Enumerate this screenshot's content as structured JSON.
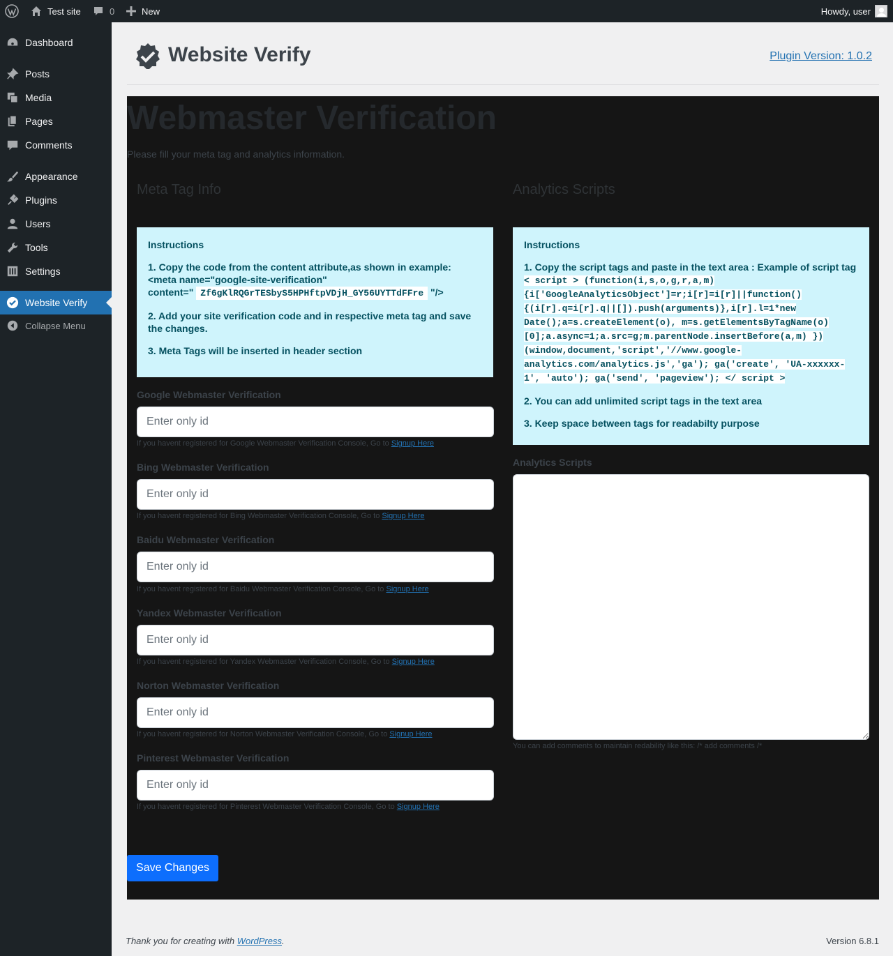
{
  "admin_bar": {
    "site_name": "Test site",
    "comments_count": "0",
    "new_label": "New",
    "howdy": "Howdy, user"
  },
  "sidebar": {
    "items": [
      {
        "label": "Dashboard",
        "icon": "dashboard-icon"
      },
      {
        "label": "Posts",
        "icon": "pin-icon"
      },
      {
        "label": "Media",
        "icon": "media-icon"
      },
      {
        "label": "Pages",
        "icon": "pages-icon"
      },
      {
        "label": "Comments",
        "icon": "comment-icon"
      },
      {
        "label": "Appearance",
        "icon": "brush-icon"
      },
      {
        "label": "Plugins",
        "icon": "plug-icon"
      },
      {
        "label": "Users",
        "icon": "user-icon"
      },
      {
        "label": "Tools",
        "icon": "wrench-icon"
      },
      {
        "label": "Settings",
        "icon": "settings-icon"
      },
      {
        "label": "Website Verify",
        "icon": "verified-badge-icon"
      },
      {
        "label": "Collapse Menu",
        "icon": "collapse-icon"
      }
    ],
    "active": "Website Verify"
  },
  "header": {
    "title": "Website Verify",
    "version_link": "Plugin Version: 1.0.2"
  },
  "panel": {
    "title": "Webmaster Verification",
    "subtitle": "Please fill your meta tag and analytics information.",
    "meta_col_title": "Meta Tag Info",
    "analytics_col_title": "Analytics Scripts"
  },
  "meta_instructions": {
    "heading": "Instructions",
    "step1": "1. Copy the code from the content attribute,as shown in example:",
    "step1_meta": "<meta name=\"google-site-verification\"",
    "step1_content_prefix": "content=\"",
    "step1_code": "Zf6gKlRQGrTESbyS5HPHftpVDjH_GY56UYTTdFFre",
    "step1_suffix": "\"/>",
    "step2": "2. Add your site verification code and in respective meta tag and save the changes.",
    "step3": "3. Meta Tags will be inserted in header section"
  },
  "analytics_instructions": {
    "heading": "Instructions",
    "step1": "1. Copy the script tags and paste in the text area : Example of script tag",
    "code": " < script > (function(i,s,o,g,r,a,m){i['GoogleAnalyticsObject']=r;i[r]=i[r]||function(){(i[r].q=i[r].q||[]).push(arguments)},i[r].l=1*new Date();a=s.createElement(o), m=s.getElementsByTagName(o)[0];a.async=1;a.src=g;m.parentNode.insertBefore(a,m) })(window,document,'script','//www.google-analytics.com/analytics.js','ga'); ga('create', 'UA-xxxxxx-1', 'auto'); ga('send', 'pageview'); </ script > ",
    "step2": "2. You can add unlimited script tags in the text area",
    "step3": "3. Keep space between tags for readabilty purpose"
  },
  "fields": [
    {
      "label": "Google Webmaster Verification",
      "placeholder": "Enter only id",
      "help": "If you havent registered for Google Webmaster Verification Console, Go to",
      "link": "Signup Here"
    },
    {
      "label": "Bing Webmaster Verification",
      "placeholder": "Enter only id",
      "help": "If you havent registered for Bing Webmaster Verification Console, Go to",
      "link": "Signup Here"
    },
    {
      "label": "Baidu Webmaster Verification",
      "placeholder": "Enter only id",
      "help": "If you havent registered for Baidu Webmaster Verification Console, Go to",
      "link": "Signup Here"
    },
    {
      "label": "Yandex Webmaster Verification",
      "placeholder": "Enter only id",
      "help": "If you havent registered for Yandex Webmaster Verification Console, Go to",
      "link": "Signup Here"
    },
    {
      "label": "Norton Webmaster Verification",
      "placeholder": "Enter only id",
      "help": "If you havent registered for Norton Webmaster Verification Console, Go to",
      "link": "Signup Here"
    },
    {
      "label": "Pinterest Webmaster Verification",
      "placeholder": "Enter only id",
      "help": "If you havent registered for Pinterest Webmaster Verification Console, Go to",
      "link": "Signup Here"
    }
  ],
  "analytics": {
    "label": "Analytics Scripts",
    "value": "",
    "help": "You can add comments to maintain redability like this: /* add comments /*"
  },
  "save_label": "Save Changes",
  "footer": {
    "thanks_prefix": "Thank you for creating with",
    "thanks_link": "WordPress",
    "thanks_suffix": ".",
    "version": "Version 6.8.1"
  },
  "colors": {
    "admin_bg": "#1d2327",
    "active_menu": "#2271b1",
    "info_bg": "#cff4fc",
    "info_text": "#055160",
    "primary_button": "#0d6efd",
    "panel_bg": "#151515"
  }
}
